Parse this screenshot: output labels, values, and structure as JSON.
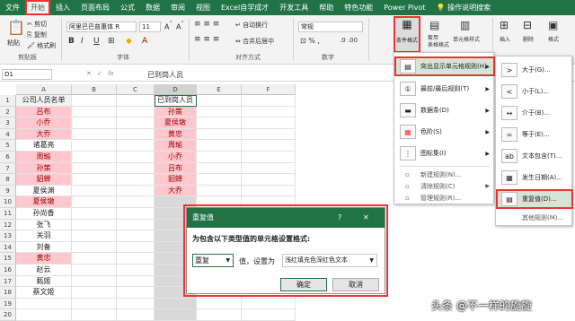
{
  "tabs": [
    "文件",
    "开始",
    "插入",
    "页面布局",
    "公式",
    "数据",
    "审阅",
    "视图",
    "Excel自学成才",
    "开发工具",
    "帮助",
    "特色功能",
    "Power Pivot",
    "操作说明搜索"
  ],
  "ribbon": {
    "paste": "粘贴",
    "cut": "剪切",
    "copy": "复制",
    "format_painter": "格式刷",
    "clipboard_group": "剪贴板",
    "font_name": "阿里巴巴普惠体 R",
    "font_size": "11",
    "font_group": "字体",
    "wrap_text": "自动换行",
    "merge_center": "合并后居中",
    "align_group": "对齐方式",
    "number_format": "常规",
    "number_group": "数字",
    "cond_format": "条件格式",
    "table_format": "套用\n表格格式",
    "cell_style": "单元格样式",
    "insert": "插入",
    "delete": "删除",
    "format": "格式"
  },
  "namebox": "D1",
  "formula": "已到岗人员",
  "columns": [
    "A",
    "B",
    "C",
    "D",
    "E",
    "F"
  ],
  "rows": [
    "1",
    "2",
    "3",
    "4",
    "5",
    "6",
    "7",
    "8",
    "9",
    "10",
    "11",
    "12",
    "13",
    "14",
    "15",
    "16",
    "17",
    "18",
    "19",
    "20"
  ],
  "colA": [
    "公司人员名单",
    "吕布",
    "小乔",
    "大乔",
    "诸葛亮",
    "周瑜",
    "孙策",
    "貂蝉",
    "夏侯渊",
    "夏侯墩",
    "孙尚香",
    "张飞",
    "关羽",
    "刘备",
    "黄忠",
    "赵云",
    "甄姬",
    "蔡文姬",
    "",
    ""
  ],
  "colD": [
    "已到岗人员",
    "孙策",
    "夏侯墩",
    "黄忠",
    "周瑜",
    "小乔",
    "吕布",
    "貂蝉",
    "大乔",
    "",
    "",
    "",
    "",
    "",
    "",
    "",
    "",
    "",
    "",
    ""
  ],
  "cf_menu": [
    "突出显示单元格规则(H)",
    "最前/最后规则(T)",
    "数据条(D)",
    "色阶(S)",
    "图标集(I)",
    "新建规则(N)...",
    "清除规则(C)",
    "管理规则(R)..."
  ],
  "sub_menu": [
    "大于(G)...",
    "小于(L)...",
    "介于(B)...",
    "等于(E)...",
    "文本包含(T)...",
    "发生日期(A)...",
    "重复值(D)...",
    "其他规则(M)..."
  ],
  "dialog": {
    "title": "重复值",
    "help": "?",
    "close": "✕",
    "prompt": "为包含以下类型值的单元格设置格式:",
    "type": "重复",
    "mid": "值，设置为",
    "style": "浅红填充色深红色文本",
    "ok": "确定",
    "cancel": "取消"
  },
  "watermark": "头条 @不一样的旋旋",
  "colors": {
    "excel_green": "#217346",
    "dup_fill": "#ffc7ce",
    "dup_text": "#9c0006",
    "highlight": "#ee3333"
  }
}
